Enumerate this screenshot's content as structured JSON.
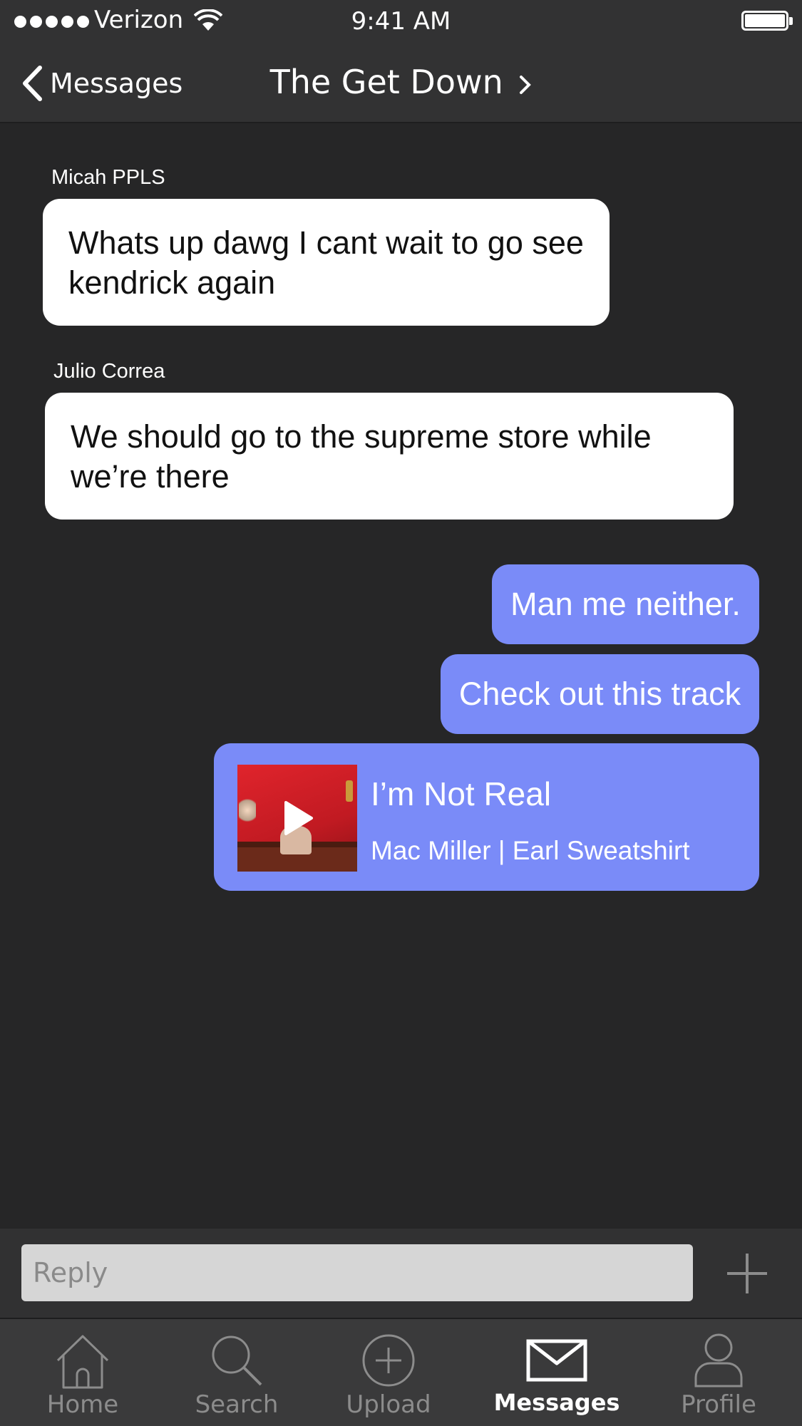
{
  "status_bar": {
    "carrier": "Verizon",
    "time": "9:41 AM"
  },
  "nav": {
    "back_label": "Messages",
    "title": "The Get Down"
  },
  "messages": [
    {
      "sender": "Micah PPLS",
      "text": "Whats up dawg I cant wait to go see kendrick again"
    },
    {
      "sender": "Julio Correa",
      "text": "We should go to the supreme store while we’re there"
    }
  ],
  "outgoing": [
    {
      "text": "Man me neither."
    },
    {
      "text": "Check out this track"
    }
  ],
  "track": {
    "title": "I’m Not Real",
    "artist": "Mac Miller | Earl Sweatshirt"
  },
  "reply": {
    "placeholder": "Reply"
  },
  "tabs": [
    {
      "label": "Home",
      "icon": "home-icon"
    },
    {
      "label": "Search",
      "icon": "search-icon"
    },
    {
      "label": "Upload",
      "icon": "upload-icon"
    },
    {
      "label": "Messages",
      "icon": "envelope-icon",
      "active": true
    },
    {
      "label": "Profile",
      "icon": "profile-icon"
    }
  ],
  "colors": {
    "background": "#262627",
    "outgoing_bubble": "#7a8bf8",
    "incoming_bubble": "#ffffff"
  }
}
